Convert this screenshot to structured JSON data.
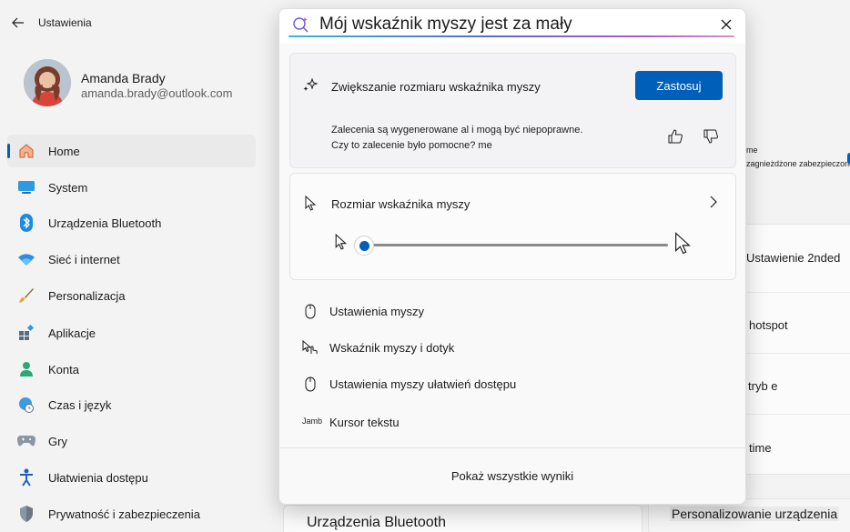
{
  "app": {
    "title": "Ustawienia"
  },
  "profile": {
    "name": "Amanda Brady",
    "email": "amanda.brady@outlook.com"
  },
  "sidebar": {
    "items": [
      {
        "label": "Home",
        "icon": "home-icon",
        "active": true
      },
      {
        "label": "System",
        "icon": "system-icon"
      },
      {
        "label": "Urządzenia Bluetooth",
        "icon": "bluetooth-icon"
      },
      {
        "label": "Sieć i internet",
        "icon": "wifi-icon"
      },
      {
        "label": "Personalizacja",
        "icon": "brush-icon"
      },
      {
        "label": "Aplikacje",
        "icon": "apps-icon"
      },
      {
        "label": "Konta",
        "icon": "person-icon"
      },
      {
        "label": "Czas i język",
        "icon": "clock-globe-icon"
      },
      {
        "label": "Gry",
        "icon": "gamepad-icon"
      },
      {
        "label": "Ułatwienia dostępu",
        "icon": "accessibility-icon"
      },
      {
        "label": "Prywatność i zabezpieczenia",
        "icon": "shield-icon"
      }
    ]
  },
  "background": {
    "small_line1": "me",
    "small_line2": "zagnieżdżone zabezpieczone",
    "rows": [
      "Ustawienie 2nded",
      "hotspot",
      "tryb e",
      "time"
    ],
    "bottom_title": "Urządzenia Bluetooth",
    "bottom_right": "Personalizowanie urządzenia"
  },
  "search": {
    "query": "Mój wskaźnik myszy jest za mały"
  },
  "suggestion": {
    "title": "Zwiększanie rozmiaru wskaźnika myszy",
    "apply_label": "Zastosuj",
    "disclaimer": "Zalecenia są wygenerowane al i mogą być niepoprawne. Czy to zalecenie było pomocne? me"
  },
  "pointer_size": {
    "title": "Rozmiar wskaźnika myszy",
    "value_fraction": 0.0
  },
  "results": [
    {
      "label": "Ustawienia myszy",
      "icon": "mouse-icon"
    },
    {
      "label": "Wskaźnik myszy i dotyk",
      "icon": "pointer-touch-icon"
    },
    {
      "label": "Ustawienia myszy ułatwień dostępu",
      "icon": "mouse-icon"
    },
    {
      "label": "Kursor tekstu",
      "prefix": "Jamb"
    }
  ],
  "footer": {
    "show_all": "Pokaż wszystkie wyniki"
  },
  "colors": {
    "accent": "#005fb8",
    "background": "#f3f3f3"
  }
}
